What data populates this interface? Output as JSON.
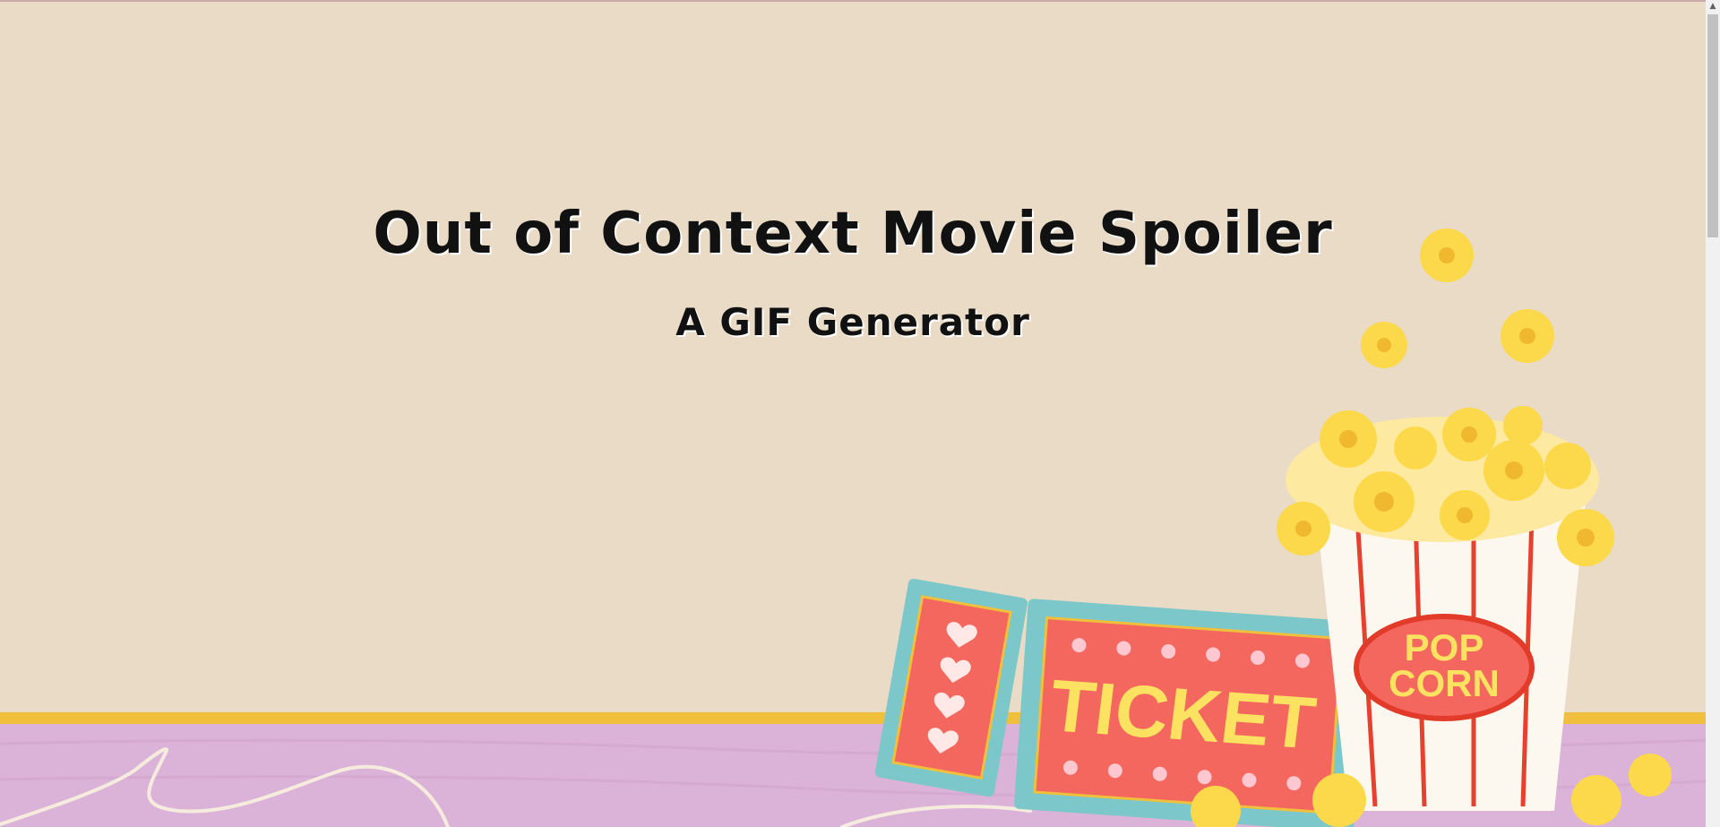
{
  "hero": {
    "title": "Out of Context Movie Spoiler",
    "subtitle": "A GIF Generator"
  },
  "illustration": {
    "ticket_label": "TICKET",
    "popcorn_label_line1": "POP",
    "popcorn_label_line2": "CORN"
  },
  "colors": {
    "wall": "#e9dbc5",
    "floor": "#dbb3d9",
    "stripe": "#f0c03c",
    "ticket_frame": "#7cc7c9",
    "ticket_red": "#f4675f",
    "popcorn_yellow": "#fde261"
  },
  "icons": {
    "scroll_up": "chevron-up-icon"
  }
}
